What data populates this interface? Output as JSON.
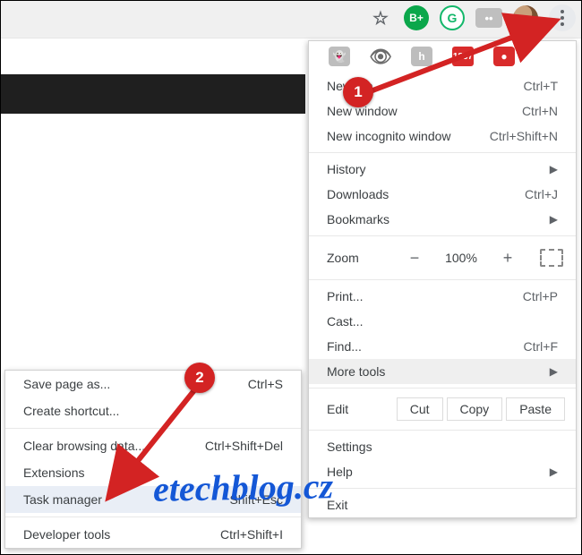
{
  "toolbar": {
    "star_tooltip": "Bookmark",
    "bplus_label": "B+",
    "g_label": "G",
    "box_label": "••"
  },
  "ext_row": {
    "ghost": "👻",
    "eye": "👁",
    "h": "h",
    "mail": "1857",
    "rss": "●"
  },
  "menu": {
    "new_tab": {
      "label": "New tab",
      "shortcut": "Ctrl+T"
    },
    "new_window": {
      "label": "New window",
      "shortcut": "Ctrl+N"
    },
    "incognito": {
      "label": "New incognito window",
      "shortcut": "Ctrl+Shift+N"
    },
    "history": {
      "label": "History"
    },
    "downloads": {
      "label": "Downloads",
      "shortcut": "Ctrl+J"
    },
    "bookmarks": {
      "label": "Bookmarks"
    },
    "zoom": {
      "label": "Zoom",
      "minus": "−",
      "value": "100%",
      "plus": "+"
    },
    "print": {
      "label": "Print...",
      "shortcut": "Ctrl+P"
    },
    "cast": {
      "label": "Cast..."
    },
    "find": {
      "label": "Find...",
      "shortcut": "Ctrl+F"
    },
    "more_tools": {
      "label": "More tools"
    },
    "edit": {
      "label": "Edit",
      "cut": "Cut",
      "copy": "Copy",
      "paste": "Paste"
    },
    "settings": {
      "label": "Settings"
    },
    "help": {
      "label": "Help"
    },
    "exit": {
      "label": "Exit"
    }
  },
  "submenu": {
    "save_page": {
      "label": "Save page as...",
      "shortcut": "Ctrl+S"
    },
    "shortcut": {
      "label": "Create shortcut..."
    },
    "clear": {
      "label": "Clear browsing data...",
      "shortcut": "Ctrl+Shift+Del"
    },
    "extensions": {
      "label": "Extensions"
    },
    "task_mgr": {
      "label": "Task manager",
      "shortcut": "Shift+Esc"
    },
    "dev_tools": {
      "label": "Developer tools",
      "shortcut": "Ctrl+Shift+I"
    }
  },
  "annotations": {
    "step1": "1",
    "step2": "2"
  },
  "watermark": "etechblog.cz"
}
